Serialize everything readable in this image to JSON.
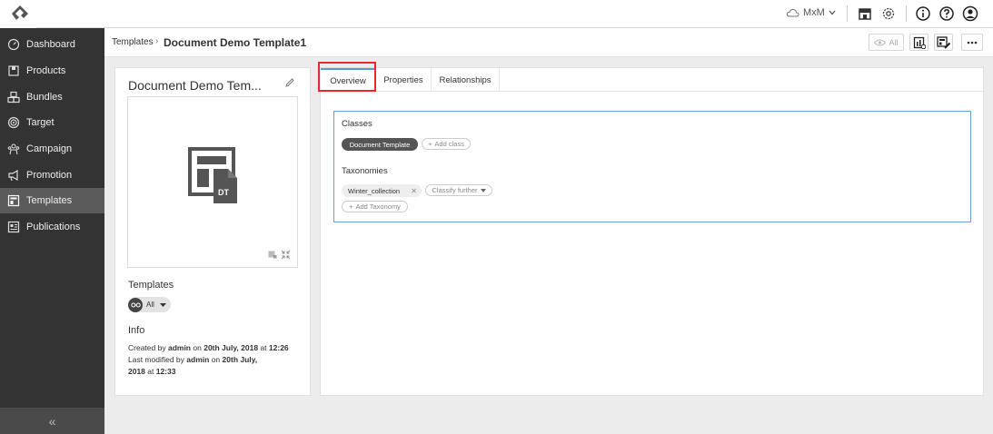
{
  "topbar": {
    "workspace": "MxM"
  },
  "sidebar": {
    "items": [
      {
        "label": "Dashboard"
      },
      {
        "label": "Products"
      },
      {
        "label": "Bundles"
      },
      {
        "label": "Target"
      },
      {
        "label": "Campaign"
      },
      {
        "label": "Promotion"
      },
      {
        "label": "Templates"
      },
      {
        "label": "Publications"
      }
    ],
    "active_index": 6,
    "collapse_glyph": "«"
  },
  "breadcrumb": {
    "parent": "Templates",
    "separator": "›",
    "current": "Document Demo Template1"
  },
  "toolbar": {
    "all_label": "All"
  },
  "left": {
    "title": "Document Demo Tem...",
    "preview_badge": "DT",
    "templates_label": "Templates",
    "templates_filter": "All",
    "info_label": "Info",
    "created_prefix": "Created by",
    "created_user": "admin",
    "created_on": "on",
    "created_date": "20th July, 2018",
    "created_at": "at",
    "created_time": "12:26",
    "modified_prefix": "Last modified by",
    "modified_user": "admin",
    "modified_on": "on",
    "modified_date_part1": "20th July,",
    "modified_date_part2": "2018",
    "modified_at": "at",
    "modified_time": "12:33"
  },
  "tabs": [
    {
      "label": "Overview"
    },
    {
      "label": "Properties"
    },
    {
      "label": "Relationships"
    }
  ],
  "overview": {
    "classes_heading": "Classes",
    "class_chip": "Document Template",
    "add_class": "Add class",
    "taxonomies_heading": "Taxonomies",
    "taxonomy_chip": "Winter_collection",
    "classify_further": "Classify further",
    "add_taxonomy": "Add Taxonomy"
  },
  "colors": {
    "sidebar_bg": "#333333",
    "sidebar_active": "#5b5b5b",
    "highlight": "#e8282f",
    "panel_border": "#6d9ecf"
  }
}
